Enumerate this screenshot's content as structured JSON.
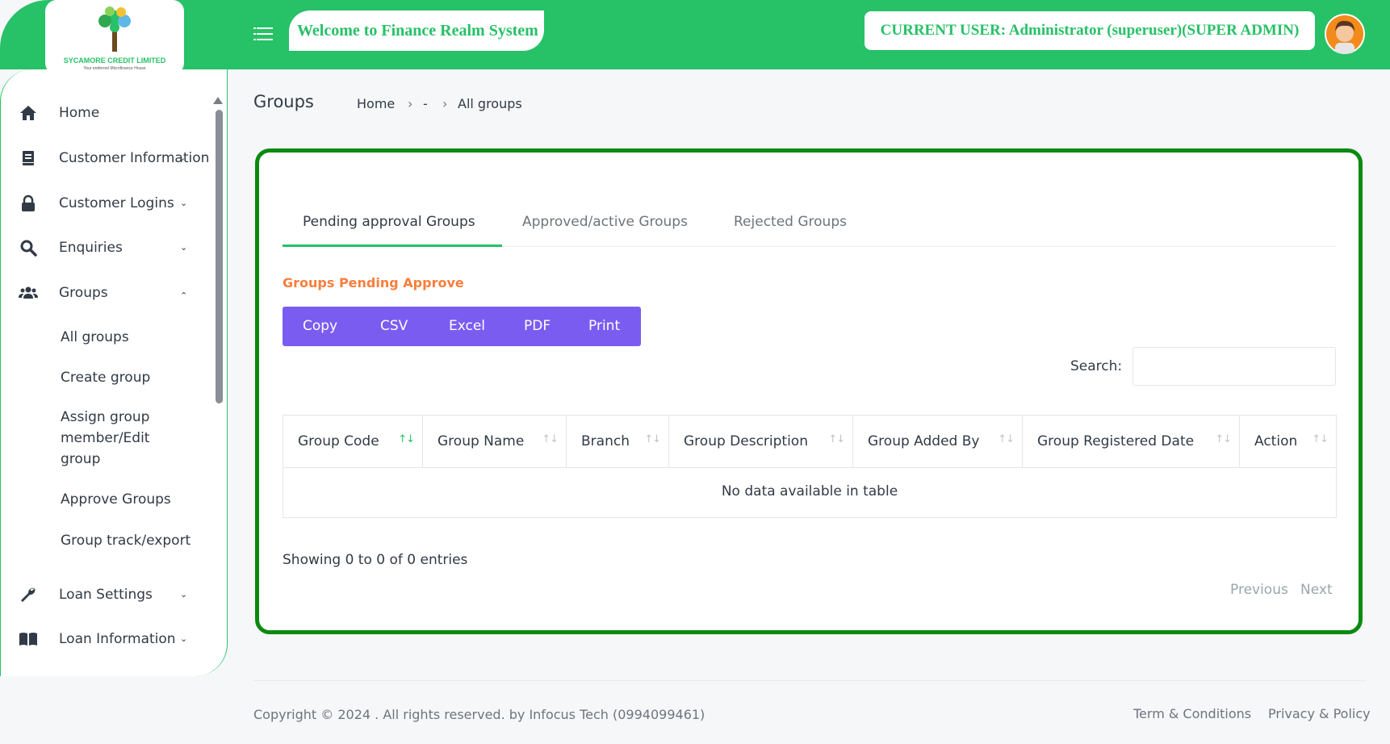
{
  "brand": {
    "company": "SYCAMORE CREDIT LIMITED",
    "tagline": "Your preferred Microfinance House",
    "primary_color": "#27c167"
  },
  "header": {
    "welcome": "Welcome to Finance Realm System",
    "current_user": "CURRENT USER: Administrator (superuser)(SUPER ADMIN)"
  },
  "sidebar": {
    "items": [
      {
        "label": "Home",
        "icon": "home-icon"
      },
      {
        "label": "Customer Information",
        "icon": "document-icon"
      },
      {
        "label": "Customer Logins",
        "icon": "lock-icon"
      },
      {
        "label": "Enquiries",
        "icon": "search-icon"
      },
      {
        "label": "Groups",
        "icon": "users-icon"
      },
      {
        "label": "Loan Settings",
        "icon": "wrench-icon"
      },
      {
        "label": "Loan Information",
        "icon": "book-icon"
      }
    ],
    "groups_sub": [
      "All groups",
      "Create group",
      "Assign group member/Edit group",
      "Approve Groups",
      "Group track/export"
    ]
  },
  "page": {
    "title": "Groups",
    "breadcrumb": [
      "Home",
      "-",
      "All groups"
    ]
  },
  "tabs": [
    "Pending approval Groups",
    "Approved/active Groups",
    "Rejected Groups"
  ],
  "section_title": "Groups Pending Approve",
  "export_buttons": [
    "Copy",
    "CSV",
    "Excel",
    "PDF",
    "Print"
  ],
  "search": {
    "label": "Search:",
    "value": ""
  },
  "table": {
    "columns": [
      "Group Code",
      "Group Name",
      "Branch",
      "Group Description",
      "Group Added By",
      "Group Registered Date",
      "Action"
    ],
    "empty_message": "No data available in table"
  },
  "info": "Showing 0 to 0 of 0 entries",
  "pagination": {
    "previous": "Previous",
    "next": "Next"
  },
  "footer": {
    "copyright": "Copyright © 2024 . All rights reserved. by Infocus Tech (0994099461)",
    "links": [
      "Term & Conditions",
      "Privacy & Policy"
    ]
  }
}
